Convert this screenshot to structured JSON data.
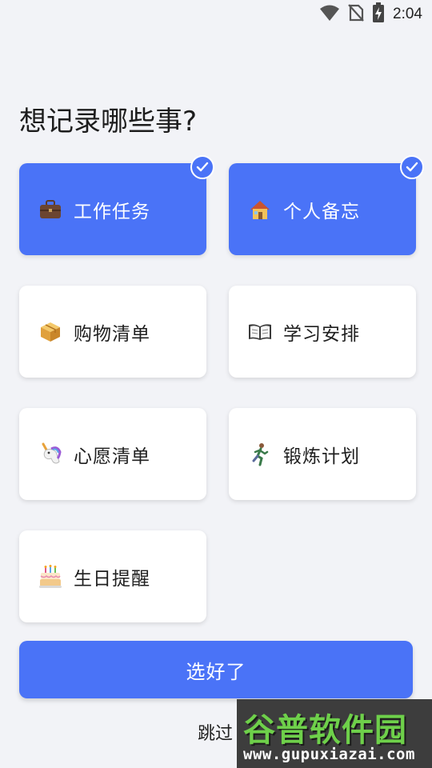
{
  "status_bar": {
    "time": "2:04",
    "icons": [
      "wifi-icon",
      "no-sim-icon",
      "battery-charging-icon"
    ]
  },
  "title": "想记录哪些事?",
  "categories": [
    {
      "label": "工作任务",
      "icon": "briefcase-icon",
      "selected": true
    },
    {
      "label": "个人备忘",
      "icon": "house-icon",
      "selected": true
    },
    {
      "label": "购物清单",
      "icon": "package-box-icon",
      "selected": false
    },
    {
      "label": "学习安排",
      "icon": "open-book-icon",
      "selected": false
    },
    {
      "label": "心愿清单",
      "icon": "unicorn-icon",
      "selected": false
    },
    {
      "label": "锻炼计划",
      "icon": "running-person-icon",
      "selected": false
    },
    {
      "label": "生日提醒",
      "icon": "birthday-cake-icon",
      "selected": false
    }
  ],
  "confirm_button": "选好了",
  "skip_link": "跳过",
  "watermark": {
    "title": "谷普软件园",
    "url": "www.gupuxiazai.com"
  },
  "colors": {
    "accent": "#4a73f7",
    "background": "#f2f3f7",
    "card": "#ffffff"
  }
}
